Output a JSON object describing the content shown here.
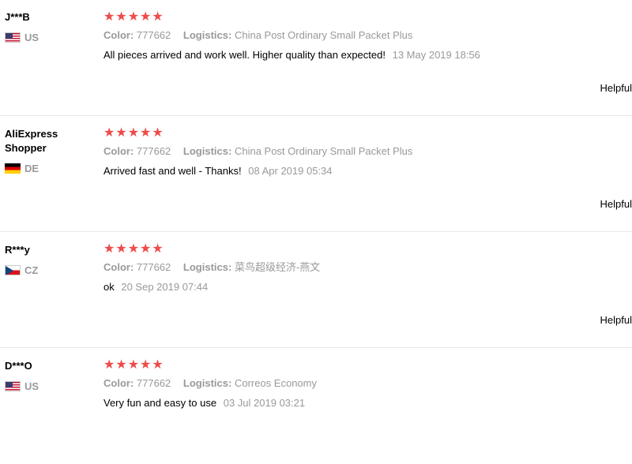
{
  "rating_stars": "★★★★★",
  "labels": {
    "color": "Color:",
    "logistics": "Logistics:",
    "helpful": "Helpful"
  },
  "reviews": [
    {
      "name": "J***B",
      "country": "US",
      "flag": "us-flag-icon",
      "color": "777662",
      "logistics": "China Post Ordinary Small Packet Plus",
      "text": "All pieces arrived and work well. Higher quality than expected!",
      "time": "13 May 2019 18:56"
    },
    {
      "name": "AliExpress Shopper",
      "country": "DE",
      "flag": "de-flag-icon",
      "color": "777662",
      "logistics": "China Post Ordinary Small Packet Plus",
      "text": "Arrived fast and well - Thanks!",
      "time": "08 Apr 2019 05:34"
    },
    {
      "name": "R***y",
      "country": "CZ",
      "flag": "cz-flag-icon",
      "color": "777662",
      "logistics": "菜鸟超级经济-燕文",
      "text": "ok",
      "time": "20 Sep 2019 07:44"
    },
    {
      "name": "D***O",
      "country": "US",
      "flag": "us-flag-icon",
      "color": "777662",
      "logistics": "Correos Economy",
      "text": "Very fun and easy to use",
      "time": "03 Jul 2019 03:21"
    }
  ]
}
